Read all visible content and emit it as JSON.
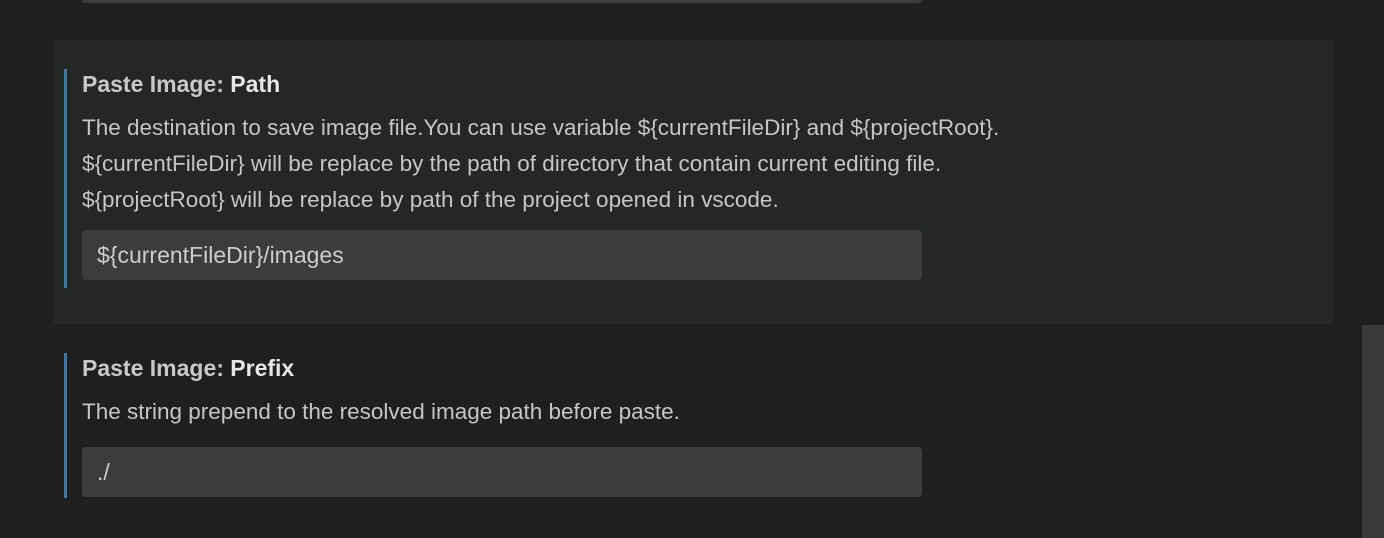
{
  "settings": [
    {
      "category": "Paste Image: ",
      "name": "Path",
      "description_lines": [
        "The destination to save image file.You can use variable ${currentFileDir} and ${projectRoot}.",
        "${currentFileDir} will be replace by the path of directory that contain current editing file.",
        "${projectRoot} will be replace by path of the project opened in vscode."
      ],
      "value": "${currentFileDir}/images"
    },
    {
      "category": "Paste Image: ",
      "name": "Prefix",
      "description_lines": [
        "The string prepend to the resolved image path before paste."
      ],
      "value": "./"
    }
  ],
  "colors": {
    "background": "#1f1f1f",
    "focused_background": "#252626",
    "accent_border": "#3b7aa6",
    "input_background": "#3c3c3c"
  }
}
